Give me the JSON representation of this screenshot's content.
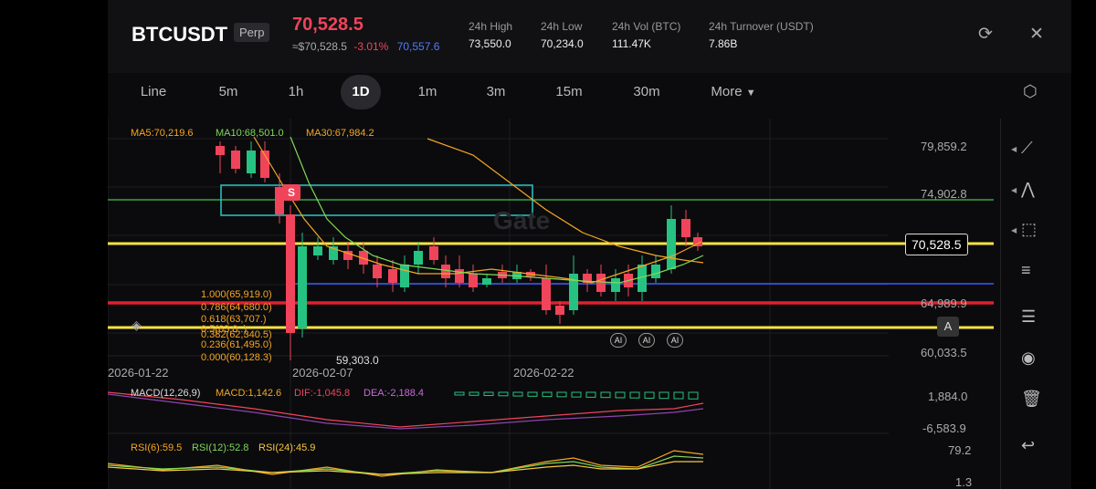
{
  "header": {
    "symbol": "BTCUSDT",
    "badge": "Perp",
    "last_price": "70,528.5",
    "usd_price": "≈$70,528.5",
    "change_pct": "-3.01%",
    "mark_price": "70,557.6",
    "stats": [
      {
        "label": "24h High",
        "value": "73,550.0"
      },
      {
        "label": "24h Low",
        "value": "70,234.0"
      },
      {
        "label": "24h Vol (BTC)",
        "value": "111.47K"
      },
      {
        "label": "24h Turnover (USDT)",
        "value": "7.86B"
      }
    ],
    "icons": [
      "refresh-icon",
      "close-icon"
    ]
  },
  "timeframes": [
    "Line",
    "5m",
    "1h",
    "1D",
    "1m",
    "3m",
    "15m",
    "30m",
    "More"
  ],
  "active_timeframe": "1D",
  "indicators": {
    "ma5": "MA5:70,219.6",
    "ma10": "MA10:68,501.0",
    "ma30": "MA30:67,984.2",
    "macd": "MACD(12,26,9)",
    "macd_val": "MACD:1,142.6",
    "dif": "DIF:-1,045.8",
    "dea": "DEA:-2,188.4",
    "rsi6": "RSI(6):59.5",
    "rsi12": "RSI(12):52.8",
    "rsi24": "RSI(24):45.9"
  },
  "fib_levels": [
    "1.000(65,919.0)",
    "0.786(64,680.0)",
    "0.618(63,707.)",
    "0.5(63,0..)",
    "0.382(62,340.5)",
    "0.236(61,495.0)",
    "0.000(60,128.3)"
  ],
  "price_axis": [
    "79,859.2",
    "74,902.8",
    "64,989.9",
    "60,033.5"
  ],
  "current_price_tag": "70,528.5",
  "low_marker": "59,303.0",
  "macd_axis": [
    "1,884.0",
    "-6,583.9"
  ],
  "rsi_axis": [
    "79.2",
    "1.3"
  ],
  "dates": [
    "2026-01-22",
    "2026-02-07",
    "2026-02-22"
  ],
  "watermark": "Gate",
  "signal_flag": "S",
  "ai_badge": "AI",
  "a_button": "A",
  "colors": {
    "up": "#26c281",
    "down": "#f0445b",
    "accent": "#4f7cff",
    "ma5": "#f5a623",
    "ma10": "#7ed957",
    "ma30": "#f5a623"
  }
}
